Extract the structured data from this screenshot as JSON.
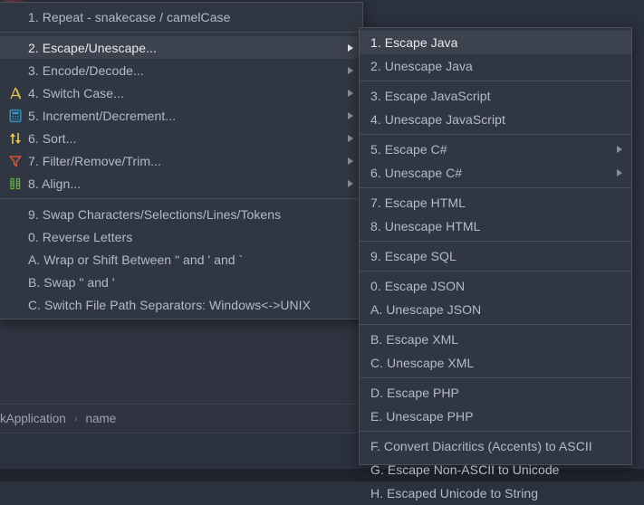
{
  "app": {
    "theme": "darcula",
    "colors": {
      "menu_bg": "#313742",
      "menu_border": "#4a505c",
      "menu_selected_bg": "#3c424e",
      "text": "#b4bac6",
      "text_bright": "#e8eaee",
      "separator": "#474d59",
      "editor_bg": "#2b313e",
      "icon_yellow": "#e8c84a",
      "icon_blue": "#3592c4",
      "icon_red": "#d4563a",
      "icon_green": "#62b543"
    }
  },
  "primary_menu": {
    "name": "string-manipulation-menu",
    "groups": [
      {
        "items": [
          {
            "mnemonic": "1.",
            "label": "1. Repeat - snakecase / camelCase",
            "icon": "none",
            "submenu": false,
            "selected": false
          }
        ]
      },
      {
        "items": [
          {
            "mnemonic": "2.",
            "label": "2. Escape/Unescape...",
            "icon": "none",
            "submenu": true,
            "selected": true
          },
          {
            "mnemonic": "3.",
            "label": "3. Encode/Decode...",
            "icon": "none",
            "submenu": true,
            "selected": false
          },
          {
            "mnemonic": "4.",
            "label": "4. Switch Case...",
            "icon": "switch-case-icon",
            "submenu": true,
            "selected": false
          },
          {
            "mnemonic": "5.",
            "label": "5. Increment/Decrement...",
            "icon": "calculator-icon",
            "submenu": true,
            "selected": false
          },
          {
            "mnemonic": "6.",
            "label": "6. Sort...",
            "icon": "sort-arrows-icon",
            "submenu": true,
            "selected": false
          },
          {
            "mnemonic": "7.",
            "label": "7. Filter/Remove/Trim...",
            "icon": "filter-funnel-icon",
            "submenu": true,
            "selected": false
          },
          {
            "mnemonic": "8.",
            "label": "8. Align...",
            "icon": "align-columns-icon",
            "submenu": true,
            "selected": false
          }
        ]
      },
      {
        "items": [
          {
            "mnemonic": "9.",
            "label": "9. Swap Characters/Selections/Lines/Tokens",
            "icon": "none",
            "submenu": false,
            "selected": false
          },
          {
            "mnemonic": "0.",
            "label": "0. Reverse Letters",
            "icon": "none",
            "submenu": false,
            "selected": false
          },
          {
            "mnemonic": "A.",
            "label": "A. Wrap or Shift Between \" and ' and `",
            "icon": "none",
            "submenu": false,
            "selected": false
          },
          {
            "mnemonic": "B.",
            "label": "B. Swap \" and '",
            "icon": "none",
            "submenu": false,
            "selected": false
          },
          {
            "mnemonic": "C.",
            "label": "C. Switch File Path Separators: Windows<->UNIX",
            "icon": "none",
            "submenu": false,
            "selected": false
          }
        ]
      }
    ]
  },
  "submenu": {
    "name": "escape-unescape-submenu",
    "groups": [
      {
        "items": [
          {
            "label": "1. Escape Java",
            "submenu": false,
            "selected": true
          },
          {
            "label": "2. Unescape Java",
            "submenu": false,
            "selected": false
          }
        ]
      },
      {
        "items": [
          {
            "label": "3. Escape JavaScript",
            "submenu": false,
            "selected": false
          },
          {
            "label": "4. Unescape JavaScript",
            "submenu": false,
            "selected": false
          }
        ]
      },
      {
        "items": [
          {
            "label": "5. Escape C#",
            "submenu": true,
            "selected": false
          },
          {
            "label": "6. Unescape C#",
            "submenu": true,
            "selected": false
          }
        ]
      },
      {
        "items": [
          {
            "label": "7. Escape HTML",
            "submenu": false,
            "selected": false
          },
          {
            "label": "8. Unescape HTML",
            "submenu": false,
            "selected": false
          }
        ]
      },
      {
        "items": [
          {
            "label": "9. Escape SQL",
            "submenu": false,
            "selected": false
          }
        ]
      },
      {
        "items": [
          {
            "label": "0. Escape JSON",
            "submenu": false,
            "selected": false
          },
          {
            "label": "A. Unescape JSON",
            "submenu": false,
            "selected": false
          }
        ]
      },
      {
        "items": [
          {
            "label": "B. Escape XML",
            "submenu": false,
            "selected": false
          },
          {
            "label": "C. Unescape XML",
            "submenu": false,
            "selected": false
          }
        ]
      },
      {
        "items": [
          {
            "label": "D. Escape PHP",
            "submenu": false,
            "selected": false
          },
          {
            "label": "E. Unescape PHP",
            "submenu": false,
            "selected": false
          }
        ]
      },
      {
        "items": [
          {
            "label": "F. Convert Diacritics (Accents) to ASCII",
            "submenu": false,
            "selected": false
          },
          {
            "label": "G. Escape Non-ASCII to Unicode",
            "submenu": false,
            "selected": false
          },
          {
            "label": "H. Escaped Unicode to String",
            "submenu": false,
            "selected": false
          }
        ]
      }
    ]
  },
  "breadcrumb": {
    "name": "editor-breadcrumb",
    "segments": [
      "kApplication",
      "name"
    ],
    "separator": "›"
  }
}
